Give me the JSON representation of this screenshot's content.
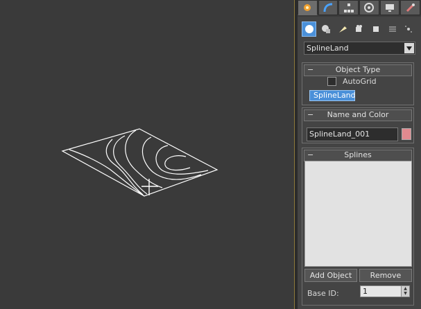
{
  "command_panel": {
    "tabs": [
      {
        "icon": "create-icon"
      },
      {
        "icon": "modify-icon"
      },
      {
        "icon": "hierarchy-icon"
      },
      {
        "icon": "motion-icon"
      },
      {
        "icon": "display-icon"
      },
      {
        "icon": "utilities-icon"
      }
    ],
    "category_icons": [
      {
        "icon": "geometry-icon",
        "active": true
      },
      {
        "icon": "shapes-icon"
      },
      {
        "icon": "lights-icon"
      },
      {
        "icon": "cameras-icon"
      },
      {
        "icon": "helpers-icon"
      },
      {
        "icon": "space-warps-icon"
      },
      {
        "icon": "systems-icon"
      }
    ],
    "subcategory": "SplineLand",
    "object_type": {
      "title": "Object Type",
      "autogrid_label": "AutoGrid",
      "autogrid_checked": false,
      "buttons": [
        "SplineLand"
      ]
    },
    "name_and_color": {
      "title": "Name and Color",
      "name_value": "SplineLand_001",
      "color": "#e08a8f"
    },
    "splines": {
      "title": "Splines",
      "add_object_label": "Add Object",
      "remove_label": "Remove",
      "base_id_label": "Base ID:",
      "base_id_value": "1"
    }
  },
  "colors": {
    "viewport_bg": "#3a3a3a",
    "panel_bg": "#444444",
    "accent": "#4a90d9"
  }
}
